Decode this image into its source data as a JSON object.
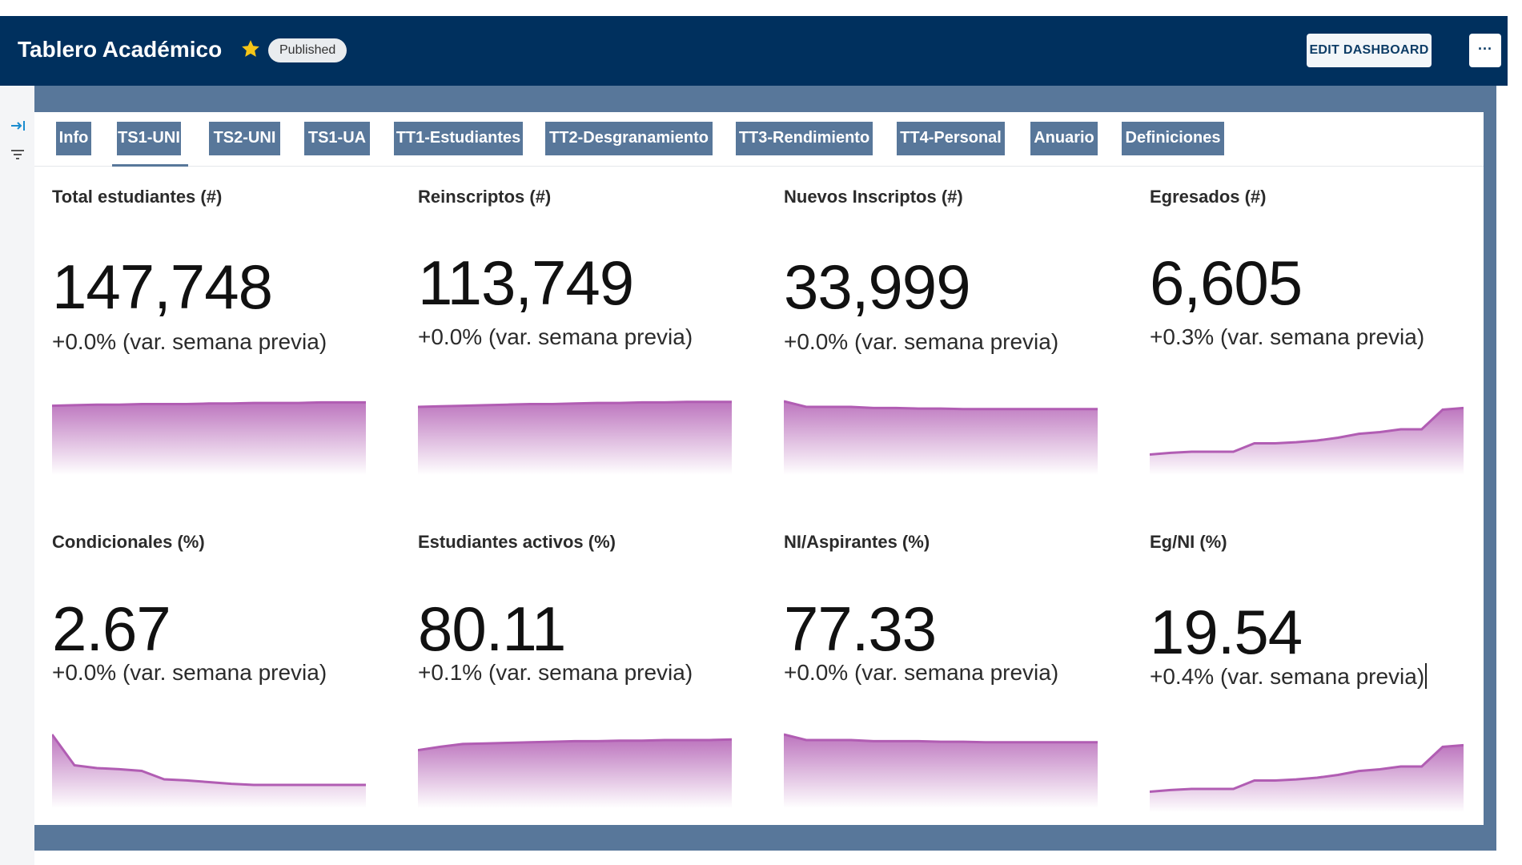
{
  "header": {
    "title": "Tablero Académico",
    "status_badge": "Published",
    "edit_button": "EDIT DASHBOARD",
    "more_button": "···",
    "bg_color": "#00305e"
  },
  "tabs": [
    {
      "label": "Info"
    },
    {
      "label": "TS1-UNI",
      "active": true
    },
    {
      "label": "TS2-UNI"
    },
    {
      "label": "TS1-UA"
    },
    {
      "label": "TT1-Estudiantes"
    },
    {
      "label": "TT2-Desgranamiento"
    },
    {
      "label": "TT3-Rendimiento"
    },
    {
      "label": "TT4-Personal"
    },
    {
      "label": "Anuario"
    },
    {
      "label": "Definiciones"
    }
  ],
  "sidebar": {
    "icons": [
      "expand-sidebar-icon",
      "filter-icon"
    ]
  },
  "accent_color": "#b15db3",
  "cards": [
    {
      "title": "Total estudiantes (#)",
      "value": "147,748",
      "change": "+0.0% (var. semana previa)",
      "trend": [
        0.92,
        0.93,
        0.94,
        0.94,
        0.95,
        0.95,
        0.95,
        0.96,
        0.96,
        0.97,
        0.97,
        0.97,
        0.98,
        0.98,
        0.98
      ]
    },
    {
      "title": "Reinscriptos (#)",
      "value": "113,749",
      "change": "+0.0% (var. semana previa)",
      "trend": [
        0.9,
        0.91,
        0.92,
        0.93,
        0.94,
        0.95,
        0.95,
        0.96,
        0.97,
        0.97,
        0.98,
        0.98,
        0.99,
        0.99,
        0.99
      ]
    },
    {
      "title": "Nuevos Inscriptos (#)",
      "value": "33,999",
      "change": "+0.0% (var. semana previa)",
      "trend": [
        1.0,
        0.9,
        0.9,
        0.9,
        0.88,
        0.88,
        0.87,
        0.87,
        0.86,
        0.86,
        0.86,
        0.86,
        0.86,
        0.86,
        0.86
      ]
    },
    {
      "title": "Egresados (#)",
      "value": "6,605",
      "change": "+0.3% (var. semana previa)",
      "trend": [
        0.05,
        0.08,
        0.1,
        0.1,
        0.1,
        0.25,
        0.25,
        0.27,
        0.3,
        0.35,
        0.42,
        0.45,
        0.5,
        0.5,
        0.85,
        0.88
      ]
    },
    {
      "title": "Condicionales (%)",
      "value": "2.67",
      "change": "+0.0% (var. semana previa)",
      "trend": [
        1.0,
        0.45,
        0.4,
        0.38,
        0.35,
        0.2,
        0.18,
        0.15,
        0.12,
        0.1,
        0.1,
        0.1,
        0.1,
        0.1,
        0.1
      ]
    },
    {
      "title": "Estudiantes activos (%)",
      "value": "80.11",
      "change": "+0.1% (var. semana previa)",
      "trend": [
        0.72,
        0.78,
        0.83,
        0.84,
        0.85,
        0.86,
        0.87,
        0.88,
        0.88,
        0.89,
        0.89,
        0.9,
        0.9,
        0.9,
        0.91
      ]
    },
    {
      "title": "NI/Aspirantes (%)",
      "value": "77.33",
      "change": "+0.0% (var. semana previa)",
      "trend": [
        1.0,
        0.9,
        0.9,
        0.9,
        0.88,
        0.88,
        0.88,
        0.87,
        0.87,
        0.86,
        0.86,
        0.86,
        0.86,
        0.86,
        0.86
      ]
    },
    {
      "title": "Eg/NI (%)",
      "value": "19.54",
      "change": "+0.4% (var. semana previa)",
      "trend": [
        0.05,
        0.08,
        0.1,
        0.1,
        0.1,
        0.25,
        0.25,
        0.27,
        0.3,
        0.35,
        0.42,
        0.45,
        0.5,
        0.5,
        0.85,
        0.88
      ]
    }
  ]
}
